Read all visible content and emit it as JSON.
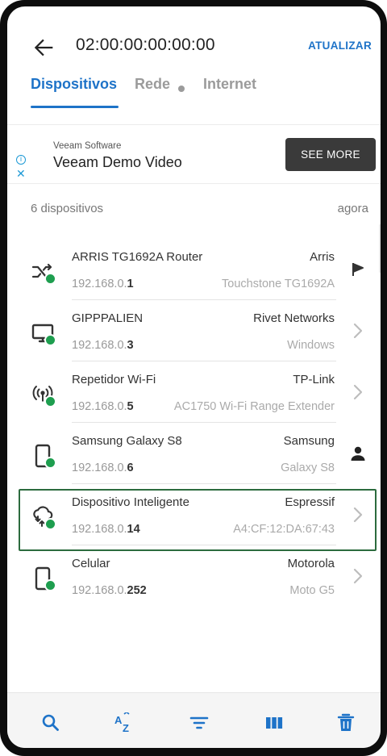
{
  "header": {
    "title": "02:00:00:00:00:00",
    "refresh_label": "ATUALIZAR",
    "back_icon": "arrow-left-icon"
  },
  "tabs": [
    {
      "label": "Dispositivos",
      "active": true
    },
    {
      "label": "Rede",
      "active": false,
      "indicator": "dot"
    },
    {
      "label": "Internet",
      "active": false
    }
  ],
  "ad": {
    "advertiser": "Veeam Software",
    "title": "Veeam Demo Video",
    "button_label": "SEE MORE"
  },
  "summary": {
    "count_label": "6 dispositivos",
    "updated_label": "agora"
  },
  "devices": [
    {
      "name": "ARRIS TG1692A Router",
      "vendor": "Arris",
      "ip_prefix": "192.168.0.",
      "ip_suffix": "1",
      "model": "Touchstone TG1692A",
      "icon": "router-shuffle-icon",
      "action": "flag-icon",
      "status_color": "#1e9e4f"
    },
    {
      "name": "GIPPPALIEN",
      "vendor": "Rivet Networks",
      "ip_prefix": "192.168.0.",
      "ip_suffix": "3",
      "model": "Windows",
      "icon": "monitor-icon",
      "action": "chevron-right-icon",
      "status_color": "#1e9e4f"
    },
    {
      "name": "Repetidor Wi-Fi",
      "vendor": "TP-Link",
      "ip_prefix": "192.168.0.",
      "ip_suffix": "5",
      "model": "AC1750 Wi-Fi Range Extender",
      "icon": "wifi-signal-icon",
      "action": "chevron-right-icon",
      "status_color": "#1e9e4f"
    },
    {
      "name": "Samsung Galaxy S8",
      "vendor": "Samsung",
      "ip_prefix": "192.168.0.",
      "ip_suffix": "6",
      "model": "Galaxy S8",
      "icon": "phone-icon",
      "action": "person-icon",
      "status_color": "#1e9e4f"
    },
    {
      "name": "Dispositivo Inteligente",
      "vendor": "Espressif",
      "ip_prefix": "192.168.0.",
      "ip_suffix": "14",
      "model": "A4:CF:12:DA:67:43",
      "icon": "cloud-sync-icon",
      "action": "chevron-right-icon",
      "status_color": "#1e9e4f",
      "highlighted": true
    },
    {
      "name": "Celular",
      "vendor": "Motorola",
      "ip_prefix": "192.168.0.",
      "ip_suffix": "252",
      "model": "Moto G5",
      "icon": "phone-icon",
      "action": "chevron-right-icon",
      "status_color": "#1e9e4f"
    }
  ],
  "bottom_bar": [
    "search-icon",
    "sort-az-icon",
    "filter-icon",
    "columns-icon",
    "trash-icon"
  ],
  "colors": {
    "accent": "#1e73c8",
    "online": "#1e9e4f",
    "highlight_border": "#2c6b3e"
  }
}
